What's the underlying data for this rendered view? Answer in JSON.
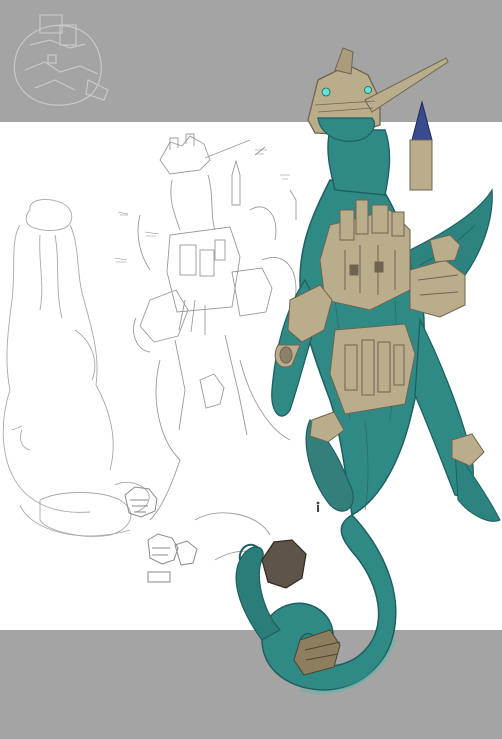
{
  "artwork": {
    "subject": "concept-art",
    "colors": {
      "band_gray": "#a4a4a4",
      "paper_white": "#ffffff",
      "pencil": "#9a9a9a",
      "teal_skin": "#2f8a86",
      "teal_shadow": "#1f5f62",
      "stone": "#b9ad8c",
      "stone_dark": "#6f6450",
      "spire_blue": "#3a4a8e",
      "eye_glow": "#66e0d0"
    }
  }
}
